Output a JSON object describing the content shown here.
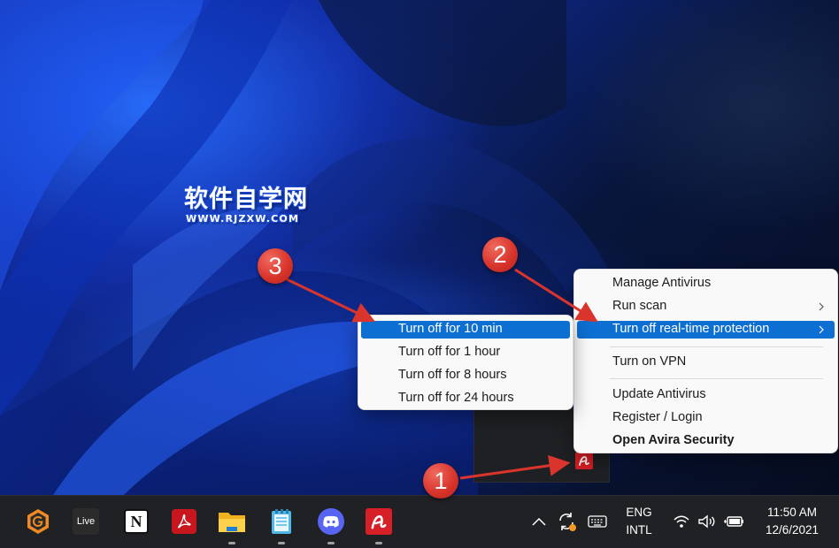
{
  "watermark": {
    "chinese": "软件自学网",
    "url": "WWW.RJZXW.COM"
  },
  "main_menu": {
    "items": [
      {
        "label": "Manage Antivirus"
      },
      {
        "label": "Run scan",
        "submenu": true
      },
      {
        "label": "Turn off real-time protection",
        "submenu": true,
        "highlighted": true
      },
      {
        "label": "Turn on VPN"
      },
      {
        "label": "Update Antivirus"
      },
      {
        "label": "Register / Login"
      },
      {
        "label": "Open Avira Security",
        "bold": true
      }
    ]
  },
  "sub_menu": {
    "items": [
      {
        "label": "Turn off for 10 min",
        "highlighted": true
      },
      {
        "label": "Turn off for 1 hour"
      },
      {
        "label": "Turn off for 8 hours"
      },
      {
        "label": "Turn off for 24 hours"
      }
    ]
  },
  "callouts": [
    "1",
    "2",
    "3"
  ],
  "taskbar": {
    "apps": [
      {
        "name": "Topaz Gigapixel",
        "icon": "gigapixel-icon"
      },
      {
        "name": "Live",
        "icon": "live-icon",
        "label": "Live"
      },
      {
        "name": "Notion",
        "icon": "notion-icon",
        "label": "N"
      },
      {
        "name": "Adobe Acrobat",
        "icon": "acrobat-icon"
      },
      {
        "name": "File Explorer",
        "icon": "folder-icon"
      },
      {
        "name": "Notepad",
        "icon": "notepad-icon"
      },
      {
        "name": "Discord",
        "icon": "discord-icon"
      },
      {
        "name": "Avira",
        "icon": "avira-icon"
      }
    ],
    "tray": {
      "language_line1": "ENG",
      "language_line2": "INTL",
      "time": "11:50 AM",
      "date": "12/6/2021"
    }
  },
  "colors": {
    "highlight": "#0d6fd1",
    "callout": "#d9352c",
    "avira_red": "#d61f26",
    "taskbar": "#202124"
  }
}
